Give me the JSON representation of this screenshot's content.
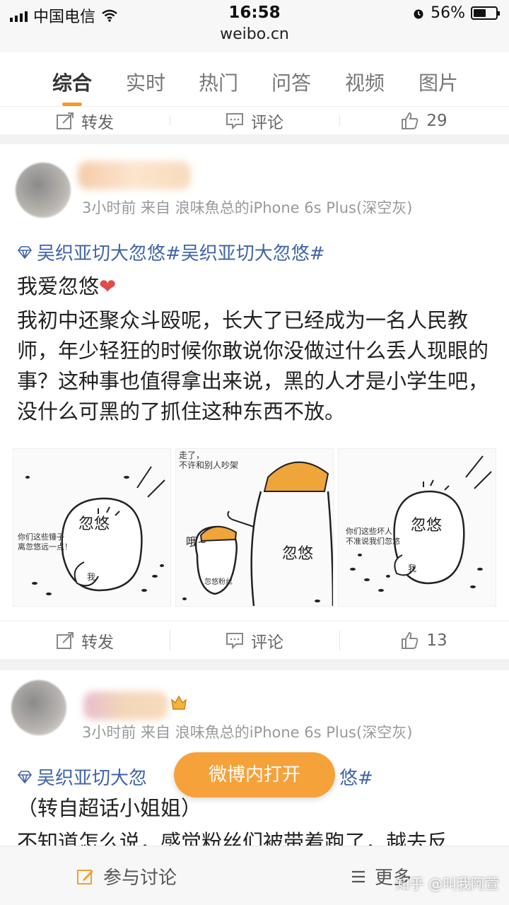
{
  "status_bar": {
    "carrier": "中国电信",
    "time": "16:58",
    "battery": "56%",
    "battery_level": 0.56
  },
  "url": "weibo.cn",
  "tabs": [
    {
      "label": "综合",
      "active": true
    },
    {
      "label": "实时",
      "active": false
    },
    {
      "label": "热门",
      "active": false
    },
    {
      "label": "问答",
      "active": false
    },
    {
      "label": "视频",
      "active": false
    },
    {
      "label": "图片",
      "active": false
    }
  ],
  "top_actions": {
    "repost": "转发",
    "comment": "评论",
    "like_count": "29"
  },
  "post1": {
    "meta": "3小时前 来自 浪味魚总的iPhone 6s Plus(深空灰)",
    "topic": "吴织亚切大忽悠#吴织亚切大忽悠#",
    "line1": "我爱忽悠",
    "heart": "❤",
    "body": "我初中还聚众斗殴呢，长大了已经成为一名人民教师，年少轻狂的时候你敢说你没做过什么丢人现眼的事？这种事也值得拿出来说，黑的人才是小学生吧，没什么可黑的了抓住这种东西不放。",
    "images": {
      "img1": {
        "big": "忽悠",
        "small": "你们这些锤子\n离忽悠远一点！",
        "me": "我"
      },
      "img2": {
        "top": "走了，\n不许和别人吵架",
        "oh": "哦~",
        "big": "忽悠",
        "small": "忽悠粉丝"
      },
      "img3": {
        "big": "忽悠",
        "small": "你们这些坏人\n不准说我们忽悠",
        "me": "我"
      }
    },
    "actions": {
      "repost": "转发",
      "comment": "评论",
      "like_count": "13"
    }
  },
  "post2": {
    "meta": "3小时前 来自 浪味魚总的iPhone 6s Plus(深空灰)",
    "topic_left": "吴织亚切大忽",
    "topic_right": "悠#",
    "line1": "（转自超话小姐姐）",
    "line2": "不知道怎么说，感觉粉丝们被带着跑了，越去反"
  },
  "floating_button": "微博内打开",
  "bottom_bar": {
    "discuss": "参与讨论",
    "more": "更多"
  },
  "watermark": "知乎 @叫我阿萱"
}
